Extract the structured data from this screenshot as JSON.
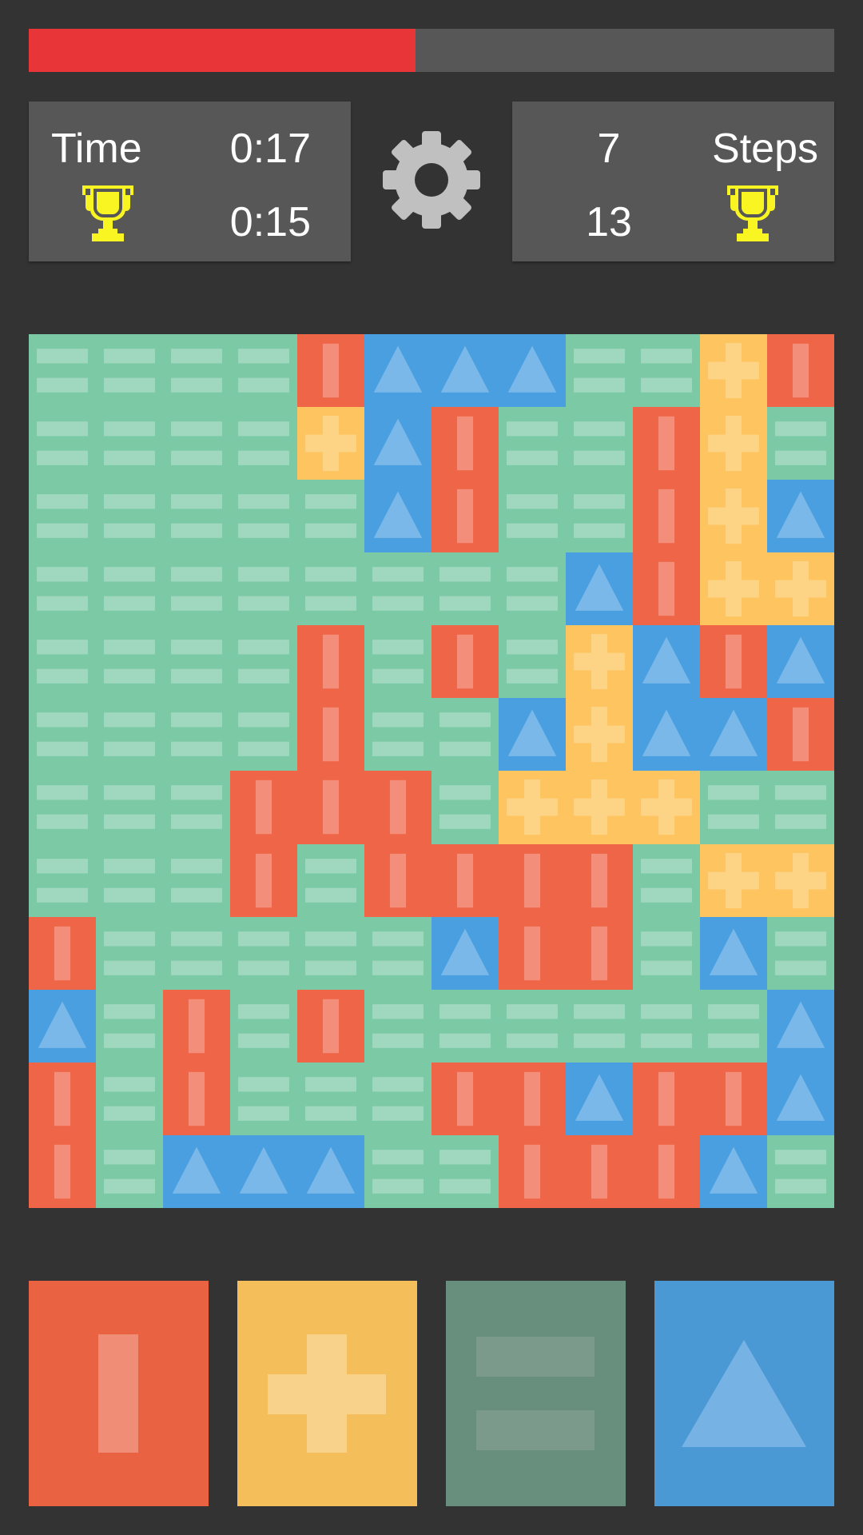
{
  "progress": {
    "fraction": 0.48,
    "fill_color": "#e83537",
    "track_color": "#575757"
  },
  "time_panel": {
    "label": "Time",
    "current": "0:17",
    "best": "0:15",
    "trophy_icon": "trophy-icon",
    "trophy_color": "#f8f523"
  },
  "settings": {
    "icon": "gear-icon",
    "color": "#c0c0c0"
  },
  "steps_panel": {
    "label": "Steps",
    "current": "7",
    "best": "13",
    "trophy_icon": "trophy-icon",
    "trophy_color": "#f8f523"
  },
  "board": {
    "colors": {
      "R": {
        "name": "red",
        "symbol": "bar",
        "bg": "#ef6547",
        "glyph": "#f38e7a"
      },
      "Y": {
        "name": "yellow",
        "symbol": "plus",
        "bg": "#fdc460",
        "glyph": "#fdd385"
      },
      "G": {
        "name": "green",
        "symbol": "equals",
        "bg": "#7cc9a6",
        "glyph": "#a0d8bf"
      },
      "B": {
        "name": "blue",
        "symbol": "triangle",
        "bg": "#4a9fe0",
        "glyph": "#7ab8ea"
      }
    },
    "rows": [
      "GGGGRBBBGGYR",
      "GGGGYBRGGRYG",
      "GGGGGBRGGRYB",
      "GGGGGGGGBRYY",
      "GGGGRGRGYBRB",
      "GGGGRGGBYBBR",
      "GGGRRRGYYYGG",
      "GGGRGRRRRGYY",
      "RGGGGGBRRGBG",
      "BGRGRGGGGGGB",
      "RGRGGGRRBRRB",
      "RGBBBGGRRRBG"
    ]
  },
  "buttons": [
    {
      "key": "R",
      "name": "red-bar-button",
      "bg": "#e96343",
      "glyph": "#f08d76",
      "symbol": "bar"
    },
    {
      "key": "Y",
      "name": "yellow-plus-button",
      "bg": "#f4be5b",
      "glyph": "#f8d18a",
      "symbol": "plus"
    },
    {
      "key": "G",
      "name": "green-equals-button",
      "bg": "#688f7e",
      "glyph": "#7b9a8c",
      "symbol": "equals"
    },
    {
      "key": "B",
      "name": "blue-triangle-button",
      "bg": "#4a98d4",
      "glyph": "#76b3e4",
      "symbol": "triangle"
    }
  ]
}
